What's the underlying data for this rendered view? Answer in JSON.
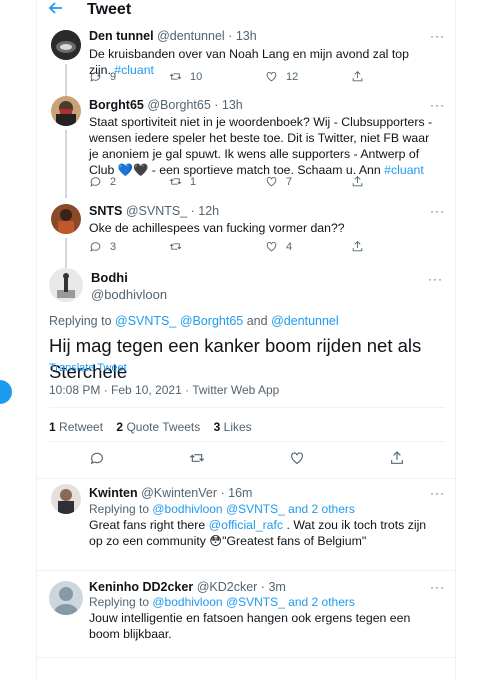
{
  "header": {
    "title": "Tweet"
  },
  "thread": [
    {
      "name": "Den tunnel",
      "handle": "@dentunnel",
      "time": "13h",
      "text_parts": [
        {
          "text": "De kruisbanden over van Noah Lang en mijn avond zal top zijn. "
        },
        {
          "text": "#cluant",
          "hashtag": true
        }
      ],
      "replies": "9",
      "retweets": "10",
      "likes": "12"
    },
    {
      "name": "Borght65",
      "handle": "@Borght65",
      "time": "13h",
      "text_parts": [
        {
          "text": "Staat sportiviteit niet in je woordenboek? Wij - Clubsupporters - wensen iedere speler het beste toe. Dit is Twitter, niet FB waar je anoniem je gal spuwt. Ik wens alle supporters - Antwerp of Club 💙🖤 - een sportieve match toe. Schaam u. Ann "
        },
        {
          "text": "#cluant",
          "hashtag": true
        }
      ],
      "replies": "2",
      "retweets": "1",
      "likes": "7"
    },
    {
      "name": "SNTS",
      "handle": "@SVNTS_",
      "time": "12h",
      "text_parts": [
        {
          "text": "Oke de achillespees van fucking vormer dan??"
        }
      ],
      "replies": "3",
      "retweets": "",
      "likes": "4"
    }
  ],
  "main_tweet": {
    "name": "Bodhi",
    "handle": "@bodhivloon",
    "replying_prefix": "Replying to ",
    "replying_users": [
      "@SVNTS_",
      "@Borght65",
      "@dentunnel"
    ],
    "replying_and": " and ",
    "text": "Hij mag tegen een kanker boom rijden net als Sterchele",
    "translate": "Translate Tweet",
    "meta": "10:08 PM · Feb 10, 2021 · Twitter Web App",
    "stats": {
      "retweets_count": "1",
      "retweets_label": "Retweet",
      "quotes_count": "2",
      "quotes_label": "Quote Tweets",
      "likes_count": "3",
      "likes_label": "Likes"
    }
  },
  "replies": [
    {
      "name": "Kwinten",
      "handle": "@KwintenVer",
      "time": "16m",
      "replying_prefix": "Replying to ",
      "replying_user1": "@bodhivloon",
      "replying_user2": "@SVNTS_",
      "replying_others": "and 2 others",
      "text_parts": [
        {
          "text": "Great fans right there "
        },
        {
          "text": "@official_rafc",
          "hashtag": true
        },
        {
          "text": " . Wat zou ik toch trots zijn op zo een community 😳\"Greatest fans of Belgium\""
        }
      ]
    },
    {
      "name": "Keninho DD2cker",
      "handle": "@KD2cker",
      "time": "3m",
      "replying_prefix": "Replying to ",
      "replying_user1": "@bodhivloon",
      "replying_user2": "@SVNTS_",
      "replying_others": "and 2 others",
      "text_parts": [
        {
          "text": "Jouw intelligentie en fatsoen hangen ook ergens tegen een boom blijkbaar."
        }
      ]
    }
  ]
}
